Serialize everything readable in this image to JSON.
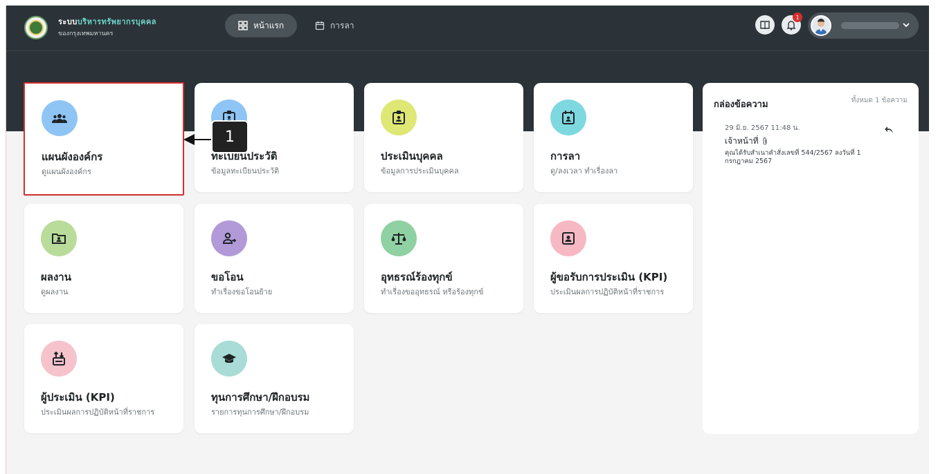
{
  "header": {
    "brand_title_prefix": "ระบบ",
    "brand_title_accent": "บริหารทรัพยากรบุคคล",
    "brand_subtitle": "ของกรุงเทพมหานคร",
    "nav_home": "หน้าแรก",
    "nav_leave": "การลา",
    "notification_count": "1"
  },
  "callout": {
    "number": "1"
  },
  "cards": [
    {
      "title": "แผนผังองค์กร",
      "sub": "ดูแผนผังองค์กร",
      "color": "#8ec5f5",
      "icon": "people-group-icon"
    },
    {
      "title": "ทะเบียนประวัติ",
      "sub": "ข้อมูลทะเบียนประวัติ",
      "color": "#8ec5f5",
      "icon": "id-badge-icon"
    },
    {
      "title": "ประเมินบุคคล",
      "sub": "ข้อมูลการประเมินบุคคล",
      "color": "#dfe775",
      "icon": "clipboard-user-icon"
    },
    {
      "title": "การลา",
      "sub": "ดู/ลงเวลา ทำเรื่องลา",
      "color": "#7ed8e0",
      "icon": "calendar-user-icon"
    },
    {
      "title": "ผลงาน",
      "sub": "ดูผลงาน",
      "color": "#b9dc9a",
      "icon": "folder-user-icon"
    },
    {
      "title": "ขอโอน",
      "sub": "ทำเรื่องขอโอนย้าย",
      "color": "#b29ad8",
      "icon": "user-transfer-icon"
    },
    {
      "title": "อุทธรณ์ร้องทุกข์",
      "sub": "ทำเรื่องขออุทธรณ์ หรือร้องทุกข์",
      "color": "#8fd1a2",
      "icon": "scale-icon"
    },
    {
      "title": "ผู้ขอรับการประเมิน (KPI)",
      "sub": "ประเมินผลการปฏิบัติหน้าที่ราชการ",
      "color": "#f6b8c3",
      "icon": "portrait-frame-icon"
    },
    {
      "title": "ผู้ประเมิน (KPI)",
      "sub": "ประเมินผลการปฏิบัติหน้าที่ราชการ",
      "color": "#f6c3cc",
      "icon": "sort-arrows-icon"
    },
    {
      "title": "ทุนการศึกษา/ฝึกอบรม",
      "sub": "รายการทุนการศึกษา/ฝึกอบรม",
      "color": "#a9dcd6",
      "icon": "graduation-cap-icon"
    }
  ],
  "messages": {
    "title": "กล่องข้อความ",
    "count": "ทั้งหมด 1 ข้อความ",
    "items": [
      {
        "date": "29 มิ.ย. 2567 11:48 น.",
        "sender": "เจ้าหน้าที่",
        "body": "คุณได้รับสำเนาคำสั่งเลขที่ 544/2567 ลงวันที่ 1 กรกฎาคม 2567"
      }
    ]
  }
}
